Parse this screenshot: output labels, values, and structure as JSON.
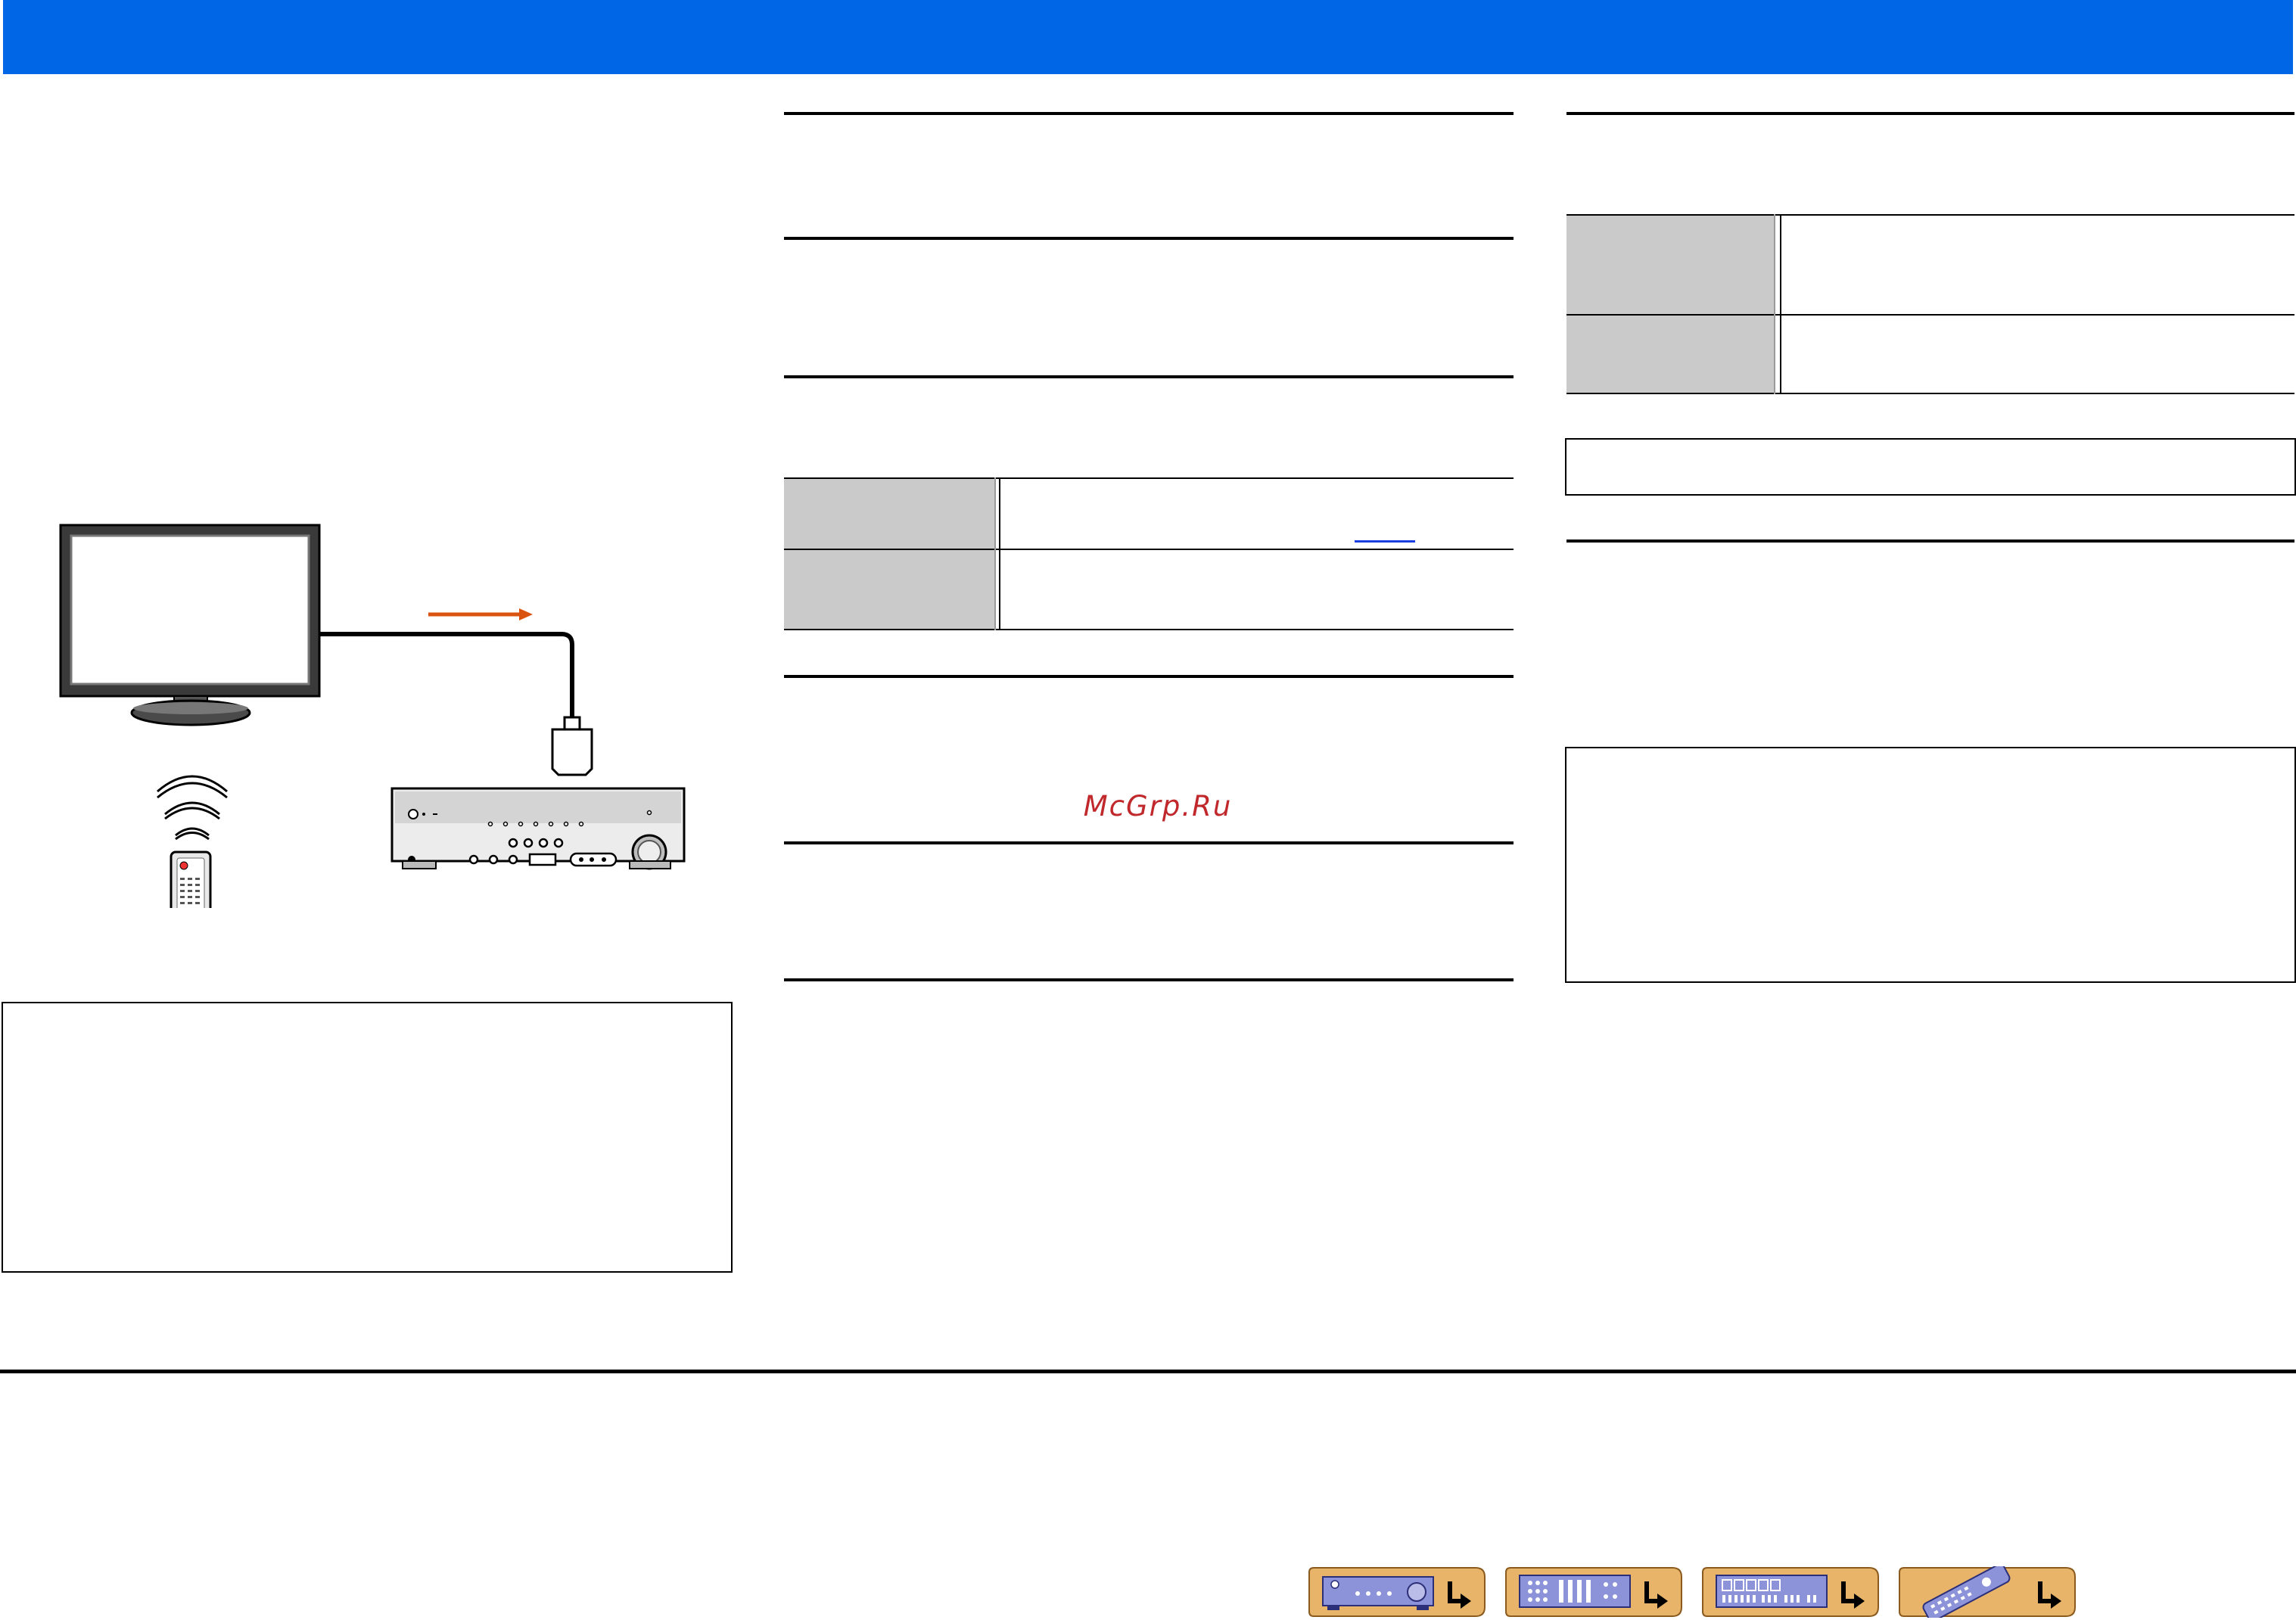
{
  "watermark": {
    "text": "McGrp.Ru"
  },
  "colors": {
    "header_bar": "#0066e6",
    "signal_arrow": "#d9530f",
    "nav_button_fill": "#e8b46a",
    "nav_button_border": "#8a5a1e",
    "table_header_cell": "#cacaca",
    "watermark": "#c0282c"
  },
  "diagram": {
    "devices": [
      "tv-icon",
      "av-receiver-icon",
      "remote-control-icon"
    ],
    "connection": "hdmi-cable"
  },
  "footer_nav": [
    {
      "name": "front-panel-nav-button",
      "icon": "front-panel-icon"
    },
    {
      "name": "rear-panel-nav-button",
      "icon": "rear-panel-icon"
    },
    {
      "name": "display-nav-button",
      "icon": "display-icon"
    },
    {
      "name": "remote-control-nav-button",
      "icon": "remote-control-icon"
    }
  ]
}
